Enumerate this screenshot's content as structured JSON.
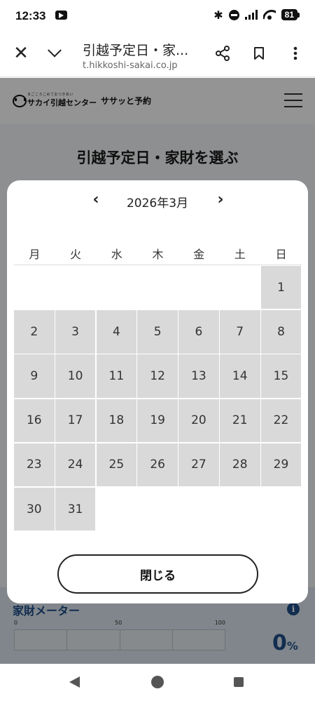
{
  "status_bar": {
    "time": "12:33",
    "battery": "81"
  },
  "browser": {
    "page_title": "引越予定日・家...",
    "url": "t.hikkoshi-sakai.co.jp",
    "close_icon": "✕"
  },
  "site": {
    "logo_tagline": "まごころこめておつきあい",
    "logo_name": "サカイ引越センター",
    "service_name": "ササッと予約",
    "heading": "引越予定日・家財を選ぶ",
    "meter": {
      "title": "家財メーター",
      "info": "i",
      "tick_0": "0",
      "tick_50": "50",
      "tick_100": "100",
      "value_fraction": 0,
      "value": "0",
      "unit": "%"
    }
  },
  "calendar": {
    "prev": "‹",
    "next": "›",
    "month_label": "2026年3月",
    "weekdays": [
      "月",
      "火",
      "水",
      "木",
      "金",
      "土",
      "日"
    ],
    "days": [
      "1",
      "2",
      "3",
      "4",
      "5",
      "6",
      "7",
      "8",
      "9",
      "10",
      "11",
      "12",
      "13",
      "14",
      "15",
      "16",
      "17",
      "18",
      "19",
      "20",
      "21",
      "22",
      "23",
      "24",
      "25",
      "26",
      "27",
      "28",
      "29",
      "30",
      "31"
    ],
    "close_label": "閉じる"
  },
  "colors": {
    "accent": "#1f4e8a",
    "day_cell": "#d9d9d9",
    "overlay": "rgba(0,0,0,0.42)"
  },
  "icons": {
    "status": [
      "record-icon",
      "bluetooth-icon",
      "do-not-disturb-icon",
      "signal-icon",
      "wifi-icon",
      "battery-icon"
    ],
    "toolbar": [
      "close-icon",
      "chevron-down-icon",
      "share-icon",
      "bookmark-icon",
      "more-vert-icon"
    ],
    "nav": [
      "back-icon",
      "home-icon",
      "recents-icon"
    ]
  }
}
